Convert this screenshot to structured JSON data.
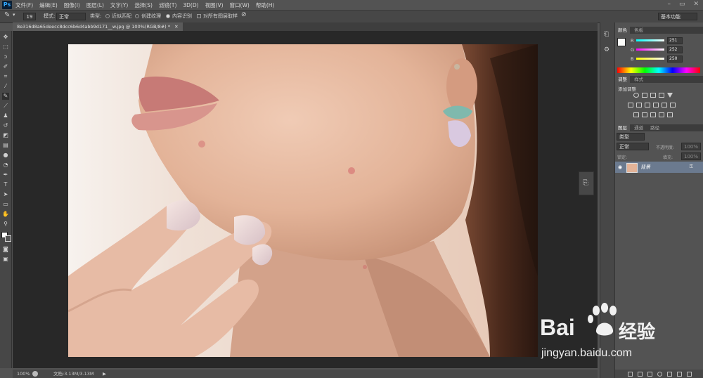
{
  "app": {
    "logo": "Ps"
  },
  "menu": [
    "文件(F)",
    "编辑(E)",
    "图像(I)",
    "图层(L)",
    "文字(Y)",
    "选择(S)",
    "滤镜(T)",
    "3D(D)",
    "视图(V)",
    "窗口(W)",
    "帮助(H)"
  ],
  "window_controls": [
    "–",
    "▭",
    "✕"
  ],
  "options": {
    "brush_size": "19",
    "mode_label": "模式:",
    "mode_value": "正常",
    "type_label": "类型:",
    "type_options": [
      "近似匹配",
      "创建纹理",
      "内容识别"
    ],
    "selected_type": "内容识别",
    "sample_all": "对所有图层取样",
    "workspace": "基本功能"
  },
  "document": {
    "tab_label": "8e316d8a65deecc8dcc6b6d4abb9d171__w.jpg @ 100%(RGB/8#) *",
    "close": "✕"
  },
  "status": {
    "zoom": "100%",
    "doc_size": "文档:3.13M/3.13M",
    "arrow": "▶"
  },
  "color_panel": {
    "tabs": [
      "颜色",
      "色板"
    ],
    "r_label": "R",
    "g_label": "G",
    "b_label": "B",
    "r": "251",
    "g": "252",
    "b": "250"
  },
  "adjust_panel": {
    "tabs": [
      "调整",
      "样式"
    ],
    "title": "添加调整"
  },
  "layers_panel": {
    "tabs": [
      "图层",
      "通道",
      "路径"
    ],
    "filter_label": "类型",
    "blend_mode": "正常",
    "opacity_label": "不透明度:",
    "opacity_value": "100%",
    "lock_label": "锁定:",
    "fill_label": "填充:",
    "fill_value": "100%",
    "layer_name": "背景"
  },
  "watermark": {
    "brand": "Bai",
    "brand_cn": "经验",
    "url": "jingyan.baidu.com"
  },
  "colors": {
    "ui_bg": "#535353",
    "canvas_bg": "#282828",
    "accent": "#31a8ff"
  }
}
